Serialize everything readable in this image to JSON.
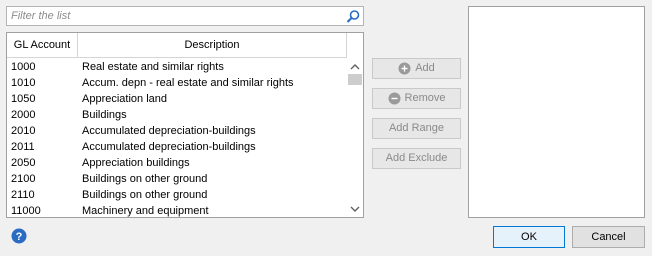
{
  "filter": {
    "placeholder": "Filter the list",
    "value": ""
  },
  "table": {
    "columns": [
      "GL Account",
      "Description"
    ],
    "rows": [
      [
        "1000",
        "Real estate and similar rights"
      ],
      [
        "1010",
        "Accum. depn - real estate and similar rights"
      ],
      [
        "1050",
        "Appreciation land"
      ],
      [
        "2000",
        "Buildings"
      ],
      [
        "2010",
        "Accumulated depreciation-buildings"
      ],
      [
        "2011",
        "Accumulated depreciation-buildings"
      ],
      [
        "2050",
        "Appreciation buildings"
      ],
      [
        "2100",
        "Buildings on other ground"
      ],
      [
        "2110",
        "Buildings on other ground"
      ],
      [
        "11000",
        "Machinery and equipment"
      ]
    ]
  },
  "buttons": {
    "add": "Add",
    "remove": "Remove",
    "add_range": "Add Range",
    "add_exclude": "Add Exclude",
    "ok": "OK",
    "cancel": "Cancel"
  },
  "icons": {
    "search": "search-icon",
    "add": "plus-circle-icon",
    "remove": "minus-circle-icon",
    "help": "help-icon"
  },
  "colors": {
    "accent": "#0078d7",
    "help": "#2a6bc4"
  }
}
